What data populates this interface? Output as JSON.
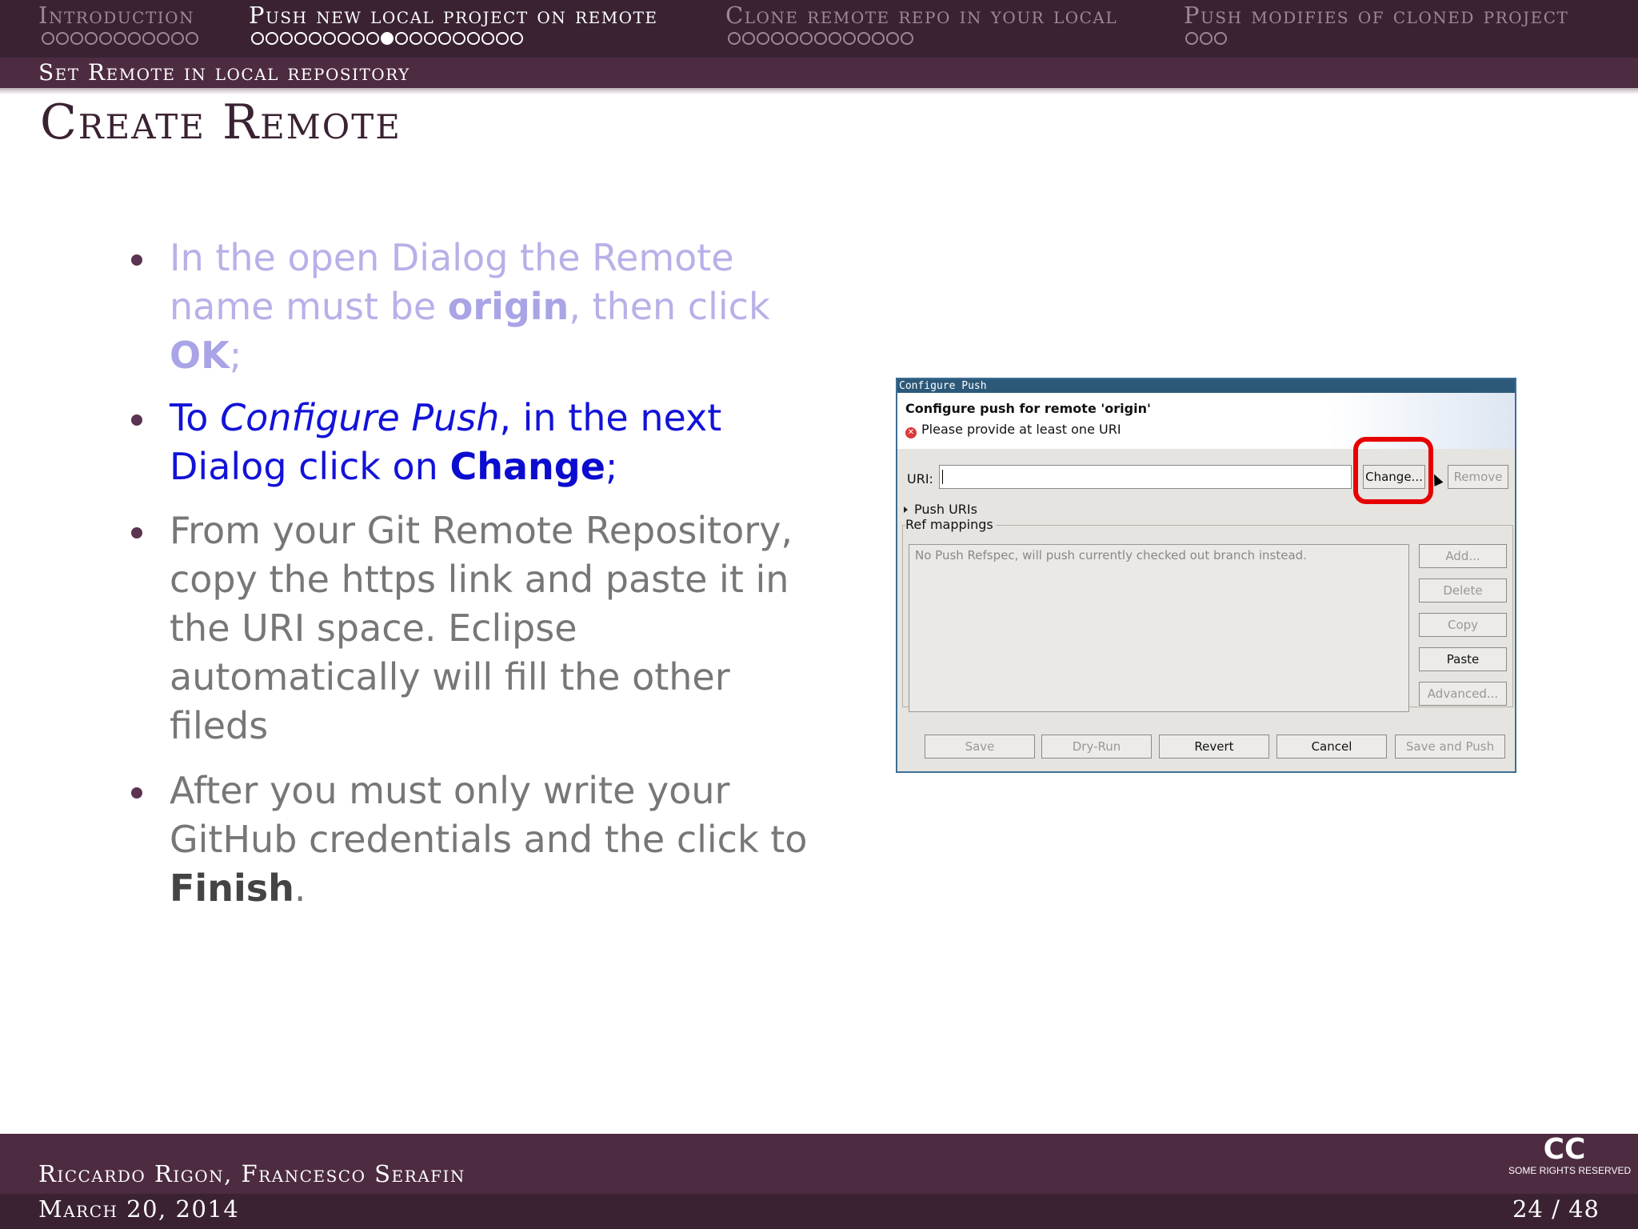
{
  "header": {
    "sections": [
      {
        "label": "Introduction",
        "dots": 11,
        "filled": -1,
        "active": false
      },
      {
        "label": "Push new local project on remote",
        "dots": 19,
        "filled": 9,
        "active": true
      },
      {
        "label": "Clone remote repo in your local",
        "dots": 13,
        "filled": -1,
        "active": false
      },
      {
        "label": "Push modifies of cloned project",
        "dots": 3,
        "filled": -1,
        "active": false
      }
    ],
    "subsection": "Set Remote in local repository"
  },
  "frame_title": "Create Remote",
  "bullets": [
    {
      "parts": [
        "In the open Dialog the Remote name must be ",
        "origin",
        ", then click ",
        "OK",
        ";"
      ]
    },
    {
      "parts": [
        "To ",
        "Configure Push",
        ", in the next Dialog click on ",
        "Change",
        ";"
      ]
    },
    {
      "text": "From your Git Remote Repository, copy the https link and paste it in the URI space.  Eclipse automatically will fill the other fileds"
    },
    {
      "parts": [
        "After you must only write your GitHub credentials and the click to ",
        "Finish",
        "."
      ]
    }
  ],
  "dialog": {
    "window_title": "Configure Push",
    "heading": "Configure push for remote 'origin'",
    "error_icon": "error-icon",
    "error": "Please provide at least one URI",
    "uri_label": "URI:",
    "uri_value": "",
    "change_button": "Change...",
    "remove_button": "Remove",
    "push_uris_label": "Push URIs",
    "ref_mappings_label": "Ref mappings",
    "ref_mappings_message": "No Push Refspec, will push currently checked out branch instead.",
    "side_buttons": [
      "Add...",
      "Delete",
      "Copy",
      "Paste",
      "Advanced..."
    ],
    "side_buttons_enabled": [
      false,
      false,
      false,
      true,
      false
    ],
    "bottom_buttons": [
      "Save",
      "Dry-Run",
      "Revert",
      "Cancel",
      "Save and Push"
    ],
    "bottom_buttons_enabled": [
      false,
      false,
      true,
      true,
      false
    ],
    "highlight_color": "#e60000",
    "titlebar_color": "#2c5979"
  },
  "footer": {
    "authors": "Riccardo Rigon, Francesco Serafin",
    "date": "March 20, 2014",
    "page": "24 / 48",
    "license_logo": "CC",
    "license_text": "SOME RIGHTS RESERVED"
  },
  "colors": {
    "theme": "#3a2233",
    "faded_text": "#b7b1e8",
    "highlight_text": "#1212d8"
  }
}
